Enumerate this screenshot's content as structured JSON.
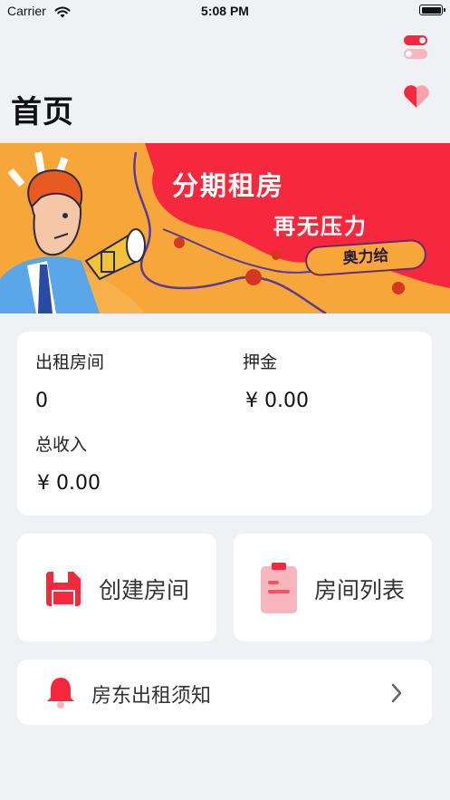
{
  "status_bar": {
    "carrier": "Carrier",
    "time": "5:08 PM"
  },
  "header": {
    "title": "首页"
  },
  "banner": {
    "title": "分期租房",
    "subtitle": "再无压力",
    "badge": "奥力给"
  },
  "stats": {
    "rented_rooms_label": "出租房间",
    "rented_rooms_value": "0",
    "deposit_label": "押金",
    "deposit_value": "¥ 0.00",
    "income_label": "总收入",
    "income_value": "¥ 0.00"
  },
  "actions": {
    "create_room": "创建房间",
    "room_list": "房间列表"
  },
  "notice": {
    "label": "房东出租须知"
  },
  "colors": {
    "accent": "#f5283e",
    "background": "#f0f1f5",
    "banner_orange": "#f7a63a"
  }
}
